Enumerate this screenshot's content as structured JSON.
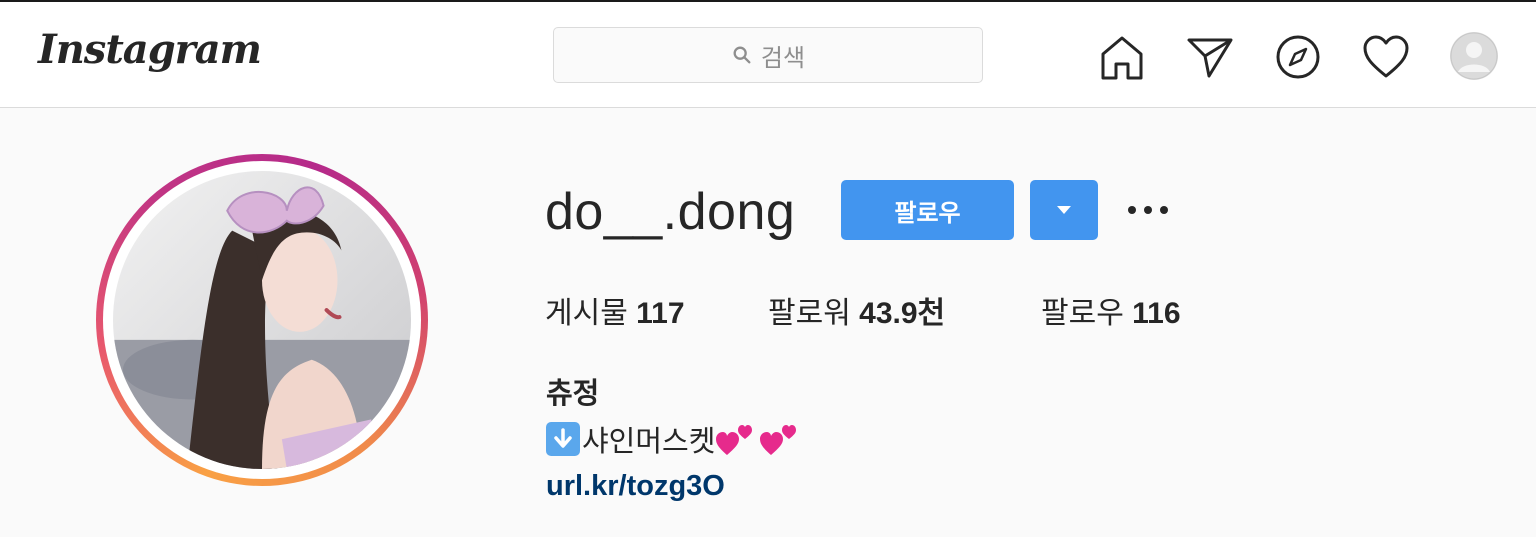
{
  "header": {
    "logo_text": "Instagram",
    "search": {
      "placeholder": "검색"
    },
    "nav": [
      {
        "name": "home-icon"
      },
      {
        "name": "direct-message-icon"
      },
      {
        "name": "explore-compass-icon"
      },
      {
        "name": "activity-heart-icon"
      },
      {
        "name": "profile-avatar-icon"
      }
    ]
  },
  "profile": {
    "username": "do__.dong",
    "follow_label": "팔로우",
    "more_label": "•••",
    "stats": [
      {
        "label": "게시물",
        "value": "117"
      },
      {
        "label": "팔로워",
        "value": "43.9천"
      },
      {
        "label": "팔로우",
        "value": "116"
      }
    ],
    "bio": {
      "name": "츄정",
      "text": "샤인머스켓",
      "arrow_icon": "down-arrow-emoji",
      "heart_icons": [
        "two-hearts-emoji",
        "two-hearts-emoji"
      ],
      "link": "url.kr/tozg3O"
    }
  },
  "colors": {
    "accent": "#4295ef",
    "link": "#00376b",
    "heart": "#e62a8c",
    "ring_start": "#f9a044",
    "ring_end": "#c13584"
  }
}
